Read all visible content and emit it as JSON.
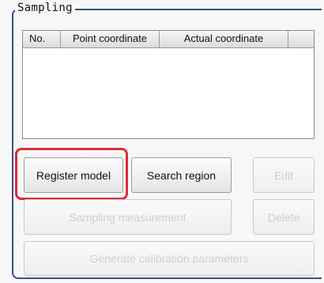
{
  "group": {
    "title": "Sampling"
  },
  "list": {
    "columns": [
      "No.",
      "Point coordinate",
      "Actual coordinate",
      ""
    ]
  },
  "buttons": {
    "register_model": "Register model",
    "search_region": "Search region",
    "edit": "Edit",
    "sampling_measurement": "Sampling measurement",
    "delete": "Delete",
    "generate_calibration": "Generate calibration parameters"
  },
  "colors": {
    "frame": "#3a4e8c",
    "highlight": "#d92d3a"
  }
}
